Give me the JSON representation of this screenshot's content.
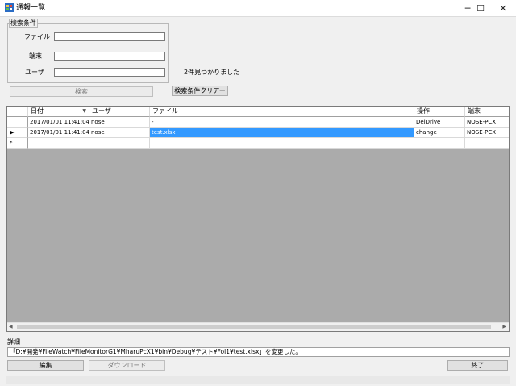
{
  "window": {
    "title": "通報一覧",
    "minimize_glyph": "─",
    "maximize_glyph": "☐",
    "close_glyph": "✕",
    "icon": "app-window-icon"
  },
  "search": {
    "group_label": "検索条件",
    "file_label": "ファイル",
    "terminal_label": "端末",
    "user_label": "ユーザ",
    "file_value": "",
    "terminal_value": "",
    "user_value": "",
    "result_count": "2件見つかりました",
    "search_button": "検索",
    "clear_button": "検索条件クリアー"
  },
  "grid": {
    "columns": [
      "日付",
      "ユーザ",
      "ファイル",
      "操作",
      "端末"
    ],
    "sort_glyph": "▼",
    "rows": [
      {
        "marker": "",
        "date": "2017/01/01 11:41:04...",
        "user": "nose",
        "file": "-",
        "action": "DelDrive",
        "terminal": "NOSE-PCX"
      },
      {
        "marker": "▶",
        "date": "2017/01/01 11:41:04...",
        "user": "nose",
        "file": "test.xlsx",
        "action": "change",
        "terminal": "NOSE-PCX"
      }
    ],
    "new_row_marker": "*",
    "scroll_left": "◀",
    "scroll_right": "▶"
  },
  "detail": {
    "label": "詳細",
    "text": "「D:¥開発¥FileWatch¥FileMonitorG1¥MharuPcX1¥bin¥Debug¥テスト¥Fol1¥test.xlsx」を変更した。"
  },
  "buttons": {
    "edit": "編集",
    "download": "ダウンロード",
    "exit": "終了"
  },
  "colors": {
    "selection": "#3399ff",
    "grid_background": "#ababab"
  }
}
